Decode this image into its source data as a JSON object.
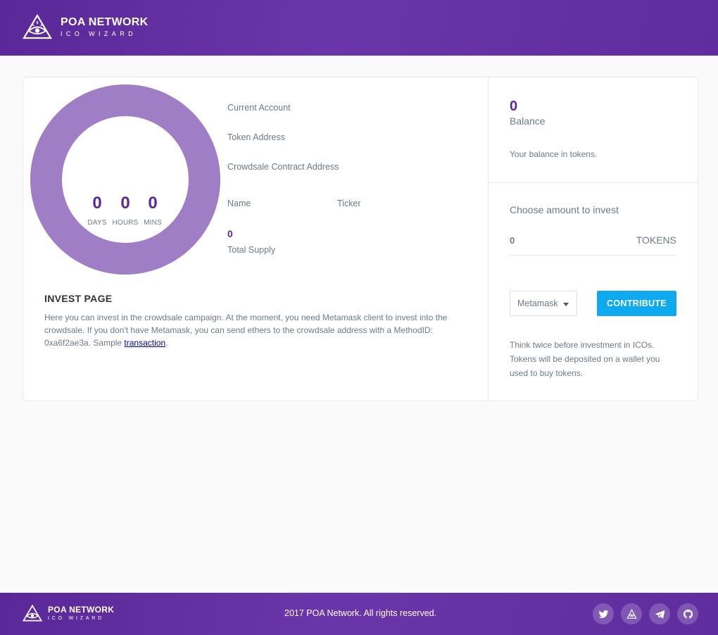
{
  "header": {
    "brand_title": "POA NETWORK",
    "brand_sub": "ICO WIZARD"
  },
  "timer": {
    "days": "0",
    "hours": "0",
    "mins": "0",
    "days_label": "DAYS",
    "hours_label": "HOURS",
    "mins_label": "MINS",
    "ring_color": "#a07ec6"
  },
  "info": {
    "current_account_label": "Current Account",
    "token_address_label": "Token Address",
    "crowdsale_address_label": "Crowdsale Contract Address",
    "name_label": "Name",
    "ticker_label": "Ticker",
    "total_supply_value": "0",
    "total_supply_label": "Total Supply"
  },
  "invest": {
    "title": "INVEST PAGE",
    "text": "Here you can invest in the crowdsale campaign. At the moment, you need Metamask client to invest into the crowdsale. If you don't have Metamask, you can send ethers to the crowdsale address with a MethodID: 0xa6f2ae3a. Sample ",
    "link_text": "transaction",
    "text_end": "."
  },
  "balance": {
    "value": "0",
    "label": "Balance",
    "description": "Your balance in tokens."
  },
  "contribute": {
    "choose_label": "Choose amount to invest",
    "amount_value": "0",
    "unit": "TOKENS",
    "wallet_selected": "Metamask",
    "button_label": "CONTRIBUTE",
    "note": "Think twice before investment in ICOs. Tokens will be deposited on a wallet you used to buy tokens."
  },
  "footer": {
    "brand_title": "POA NETWORK",
    "brand_sub": "ICO WIZARD",
    "copyright": "2017 POA Network. All rights reserved.",
    "socials": [
      "twitter-icon",
      "poa-icon",
      "telegram-icon",
      "github-icon"
    ]
  },
  "colors": {
    "brand_purple": "#5a2898",
    "accent_blue": "#0eaaf0"
  }
}
